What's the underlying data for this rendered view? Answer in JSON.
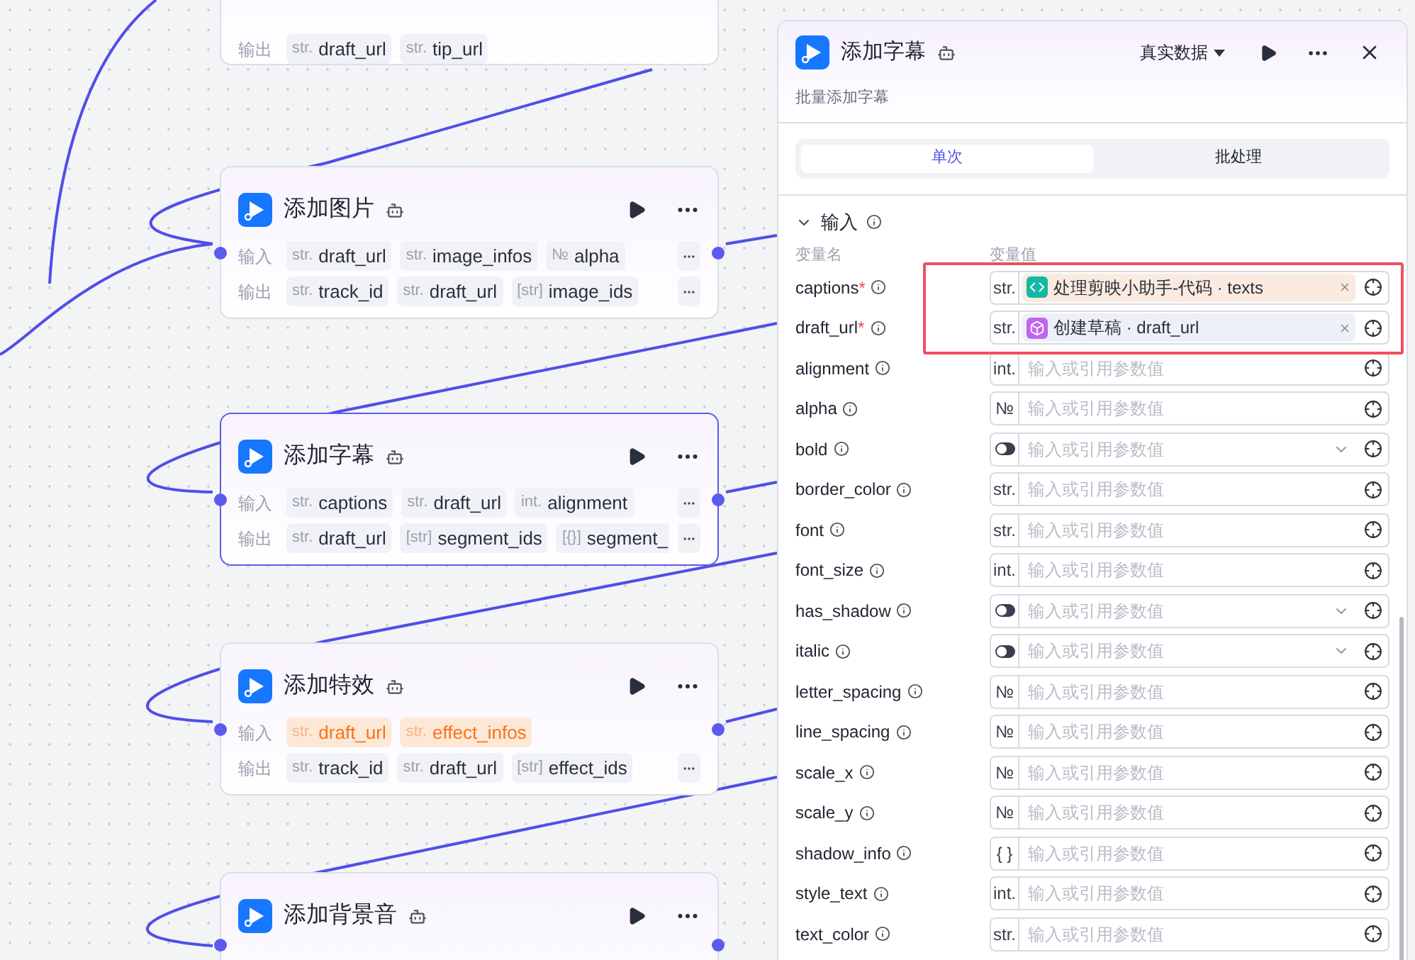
{
  "canvas": {
    "nodes": [
      {
        "rows": [
          {
            "label": "输出",
            "more": false,
            "chips": [
              {
                "type": "str.",
                "name": "draft_url",
                "highlight": false
              },
              {
                "type": "str.",
                "name": "tip_url",
                "highlight": false
              }
            ]
          }
        ]
      },
      {
        "title": "添加图片",
        "selected": false,
        "rows": [
          {
            "label": "输入",
            "more": true,
            "chips": [
              {
                "type": "str.",
                "name": "draft_url",
                "highlight": false
              },
              {
                "type": "str.",
                "name": "image_infos",
                "highlight": false
              },
              {
                "type": "№",
                "name": "alpha",
                "highlight": false
              }
            ]
          },
          {
            "label": "输出",
            "more": true,
            "chips": [
              {
                "type": "str.",
                "name": "track_id",
                "highlight": false
              },
              {
                "type": "str.",
                "name": "draft_url",
                "highlight": false
              },
              {
                "type": "[str]",
                "name": "image_ids",
                "highlight": false
              }
            ]
          }
        ]
      },
      {
        "title": "添加字幕",
        "selected": true,
        "rows": [
          {
            "label": "输入",
            "more": true,
            "chips": [
              {
                "type": "str.",
                "name": "captions",
                "highlight": false
              },
              {
                "type": "str.",
                "name": "draft_url",
                "highlight": false
              },
              {
                "type": "int.",
                "name": "alignment",
                "highlight": false
              }
            ]
          },
          {
            "label": "输出",
            "more": true,
            "chips": [
              {
                "type": "str.",
                "name": "draft_url",
                "highlight": false
              },
              {
                "type": "[str]",
                "name": "segment_ids",
                "highlight": false
              },
              {
                "type": "[{}]",
                "name": "segment_",
                "highlight": false
              }
            ]
          }
        ]
      },
      {
        "title": "添加特效",
        "selected": false,
        "rows": [
          {
            "label": "输入",
            "more": false,
            "chips": [
              {
                "type": "str.",
                "name": "draft_url",
                "highlight": true
              },
              {
                "type": "str.",
                "name": "effect_infos",
                "highlight": true
              }
            ]
          },
          {
            "label": "输出",
            "more": true,
            "chips": [
              {
                "type": "str.",
                "name": "track_id",
                "highlight": false
              },
              {
                "type": "str.",
                "name": "draft_url",
                "highlight": false
              },
              {
                "type": "[str]",
                "name": "effect_ids",
                "highlight": false
              }
            ]
          }
        ]
      },
      {
        "title": "添加背景音",
        "selected": false
      }
    ]
  },
  "panel": {
    "title": "添加字幕",
    "data_mode": "真实数据",
    "subtitle": "批量添加字幕",
    "tabs": [
      {
        "label": "单次",
        "selected": true
      },
      {
        "label": "批处理",
        "selected": false
      }
    ],
    "section": {
      "title": "输入",
      "expanded": true
    },
    "columns": [
      "变量名",
      "变量值"
    ],
    "annotated_params": [
      {
        "name": "captions",
        "required_mark": "*",
        "kind": "ref",
        "type": "str.",
        "ref": {
          "kind": "code",
          "color": "#14b8a6",
          "text": "处理剪映小助手-代码 · texts"
        }
      },
      {
        "name": "draft_url",
        "required_mark": "*",
        "kind": "ref",
        "type": "str.",
        "ref": {
          "kind": "node",
          "color": "#c264f0",
          "text": "创建草稿 · draft_url"
        }
      }
    ],
    "params": [
      {
        "name": "alignment",
        "kind": "input",
        "type": "int.",
        "placeholder": "输入或引用参数值"
      },
      {
        "name": "alpha",
        "kind": "input",
        "type": "№",
        "placeholder": "输入或引用参数值"
      },
      {
        "name": "bold",
        "kind": "toggle",
        "on": false,
        "placeholder": "输入或引用参数值"
      },
      {
        "name": "border_color",
        "kind": "input",
        "type": "str.",
        "placeholder": "输入或引用参数值"
      },
      {
        "name": "font",
        "kind": "input",
        "type": "str.",
        "placeholder": "输入或引用参数值"
      },
      {
        "name": "font_size",
        "kind": "input",
        "type": "int.",
        "placeholder": "输入或引用参数值"
      },
      {
        "name": "has_shadow",
        "kind": "toggle",
        "on": false,
        "placeholder": "输入或引用参数值"
      },
      {
        "name": "italic",
        "kind": "toggle",
        "on": false,
        "placeholder": "输入或引用参数值"
      },
      {
        "name": "letter_spacing",
        "kind": "input",
        "type": "№",
        "placeholder": "输入或引用参数值"
      },
      {
        "name": "line_spacing",
        "kind": "input",
        "type": "№",
        "placeholder": "输入或引用参数值"
      },
      {
        "name": "scale_x",
        "kind": "input",
        "type": "№",
        "placeholder": "输入或引用参数值"
      },
      {
        "name": "scale_y",
        "kind": "input",
        "type": "№",
        "placeholder": "输入或引用参数值"
      },
      {
        "name": "shadow_info",
        "kind": "input",
        "type": "{ }",
        "placeholder": "输入或引用参数值"
      },
      {
        "name": "style_text",
        "kind": "input",
        "type": "int.",
        "placeholder": "输入或引用参数值"
      },
      {
        "name": "text_color",
        "kind": "input",
        "type": "str.",
        "placeholder": "输入或引用参数值"
      }
    ]
  }
}
